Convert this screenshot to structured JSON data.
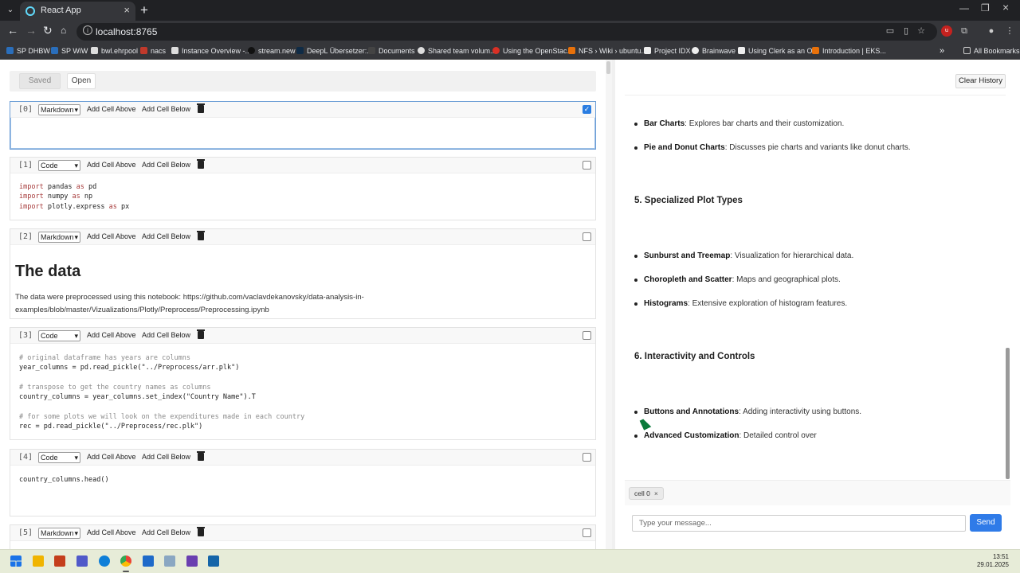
{
  "browser": {
    "tab_title": "React App",
    "url": "localhost:8765",
    "bookmarks": [
      "SP DHBW",
      "SP WiW",
      "bwl.ehrpool",
      "nacs",
      "Instance Overview -...",
      "stream.new",
      "DeepL Übersetzer:...",
      "Documents",
      "Shared team volum...",
      "Using the OpenStac...",
      "NFS › Wiki › ubuntu...",
      "Project IDX",
      "Brainwave",
      "Using Clerk as an O...",
      "Introduction | EKS..."
    ],
    "all_bookmarks": "All Bookmarks"
  },
  "notebook": {
    "saved_label": "Saved",
    "open_label": "Open",
    "add_above_label": "Add Cell Above",
    "add_below_label": "Add Cell Below",
    "cells": [
      {
        "index": "[0]",
        "type": "Markdown",
        "checked": true
      },
      {
        "index": "[1]",
        "type": "Code",
        "lines": [
          {
            "kw": "import",
            "rest": " pandas ",
            "kw2": "as",
            "rest2": " pd"
          },
          {
            "kw": "import",
            "rest": " numpy ",
            "kw2": "as",
            "rest2": " np"
          },
          {
            "kw": "import",
            "rest": " plotly.express ",
            "kw2": "as",
            "rest2": " px"
          }
        ]
      },
      {
        "index": "[2]",
        "type": "Markdown",
        "heading": "The data",
        "text": "The data were preprocessed using this notebook: https://github.com/vaclavdekanovsky/data-analysis-in-examples/blob/master/Vizualizations/Plotly/Preprocess/Preprocessing.ipynb"
      },
      {
        "index": "[3]",
        "type": "Code",
        "lines": [
          "# original dataframe has years are columns",
          "year_columns = pd.read_pickle(\"../Preprocess/arr.plk\")",
          "",
          "# transpose to get the country names as columns",
          "country_columns = year_columns.set_index(\"Country Name\").T",
          "",
          "# for some plots we will look on the expenditures made in each country",
          "rec = pd.read_pickle(\"../Preprocess/rec.plk\")"
        ]
      },
      {
        "index": "[4]",
        "type": "Code",
        "lines": [
          "country_columns.head()"
        ]
      },
      {
        "index": "[5]",
        "type": "Markdown"
      }
    ]
  },
  "chat": {
    "clear_label": "Clear History",
    "items": [
      {
        "bold": "Bar Charts",
        "text": ": Explores bar charts and their customization."
      },
      {
        "bold": "Pie and Donut Charts",
        "text": ": Discusses pie charts and variants like donut charts."
      },
      {
        "heading": "5. Specialized Plot Types"
      },
      {
        "bold": "Sunburst and Treemap",
        "text": ": Visualization for hierarchical data."
      },
      {
        "bold": "Choropleth and Scatter",
        "text": ": Maps and geographical plots."
      },
      {
        "bold": "Histograms",
        "text": ": Extensive exploration of histogram features."
      },
      {
        "heading": "6. Interactivity and Controls"
      },
      {
        "bold": "Buttons and Annotations",
        "text": ": Adding interactivity using buttons."
      },
      {
        "bold": "Advanced Customization",
        "text": ": Detailed control over"
      }
    ],
    "context_chip": "cell 0",
    "input_placeholder": "Type your message...",
    "send_label": "Send"
  },
  "taskbar": {
    "time": "13:51",
    "date": "29.01.2025"
  }
}
